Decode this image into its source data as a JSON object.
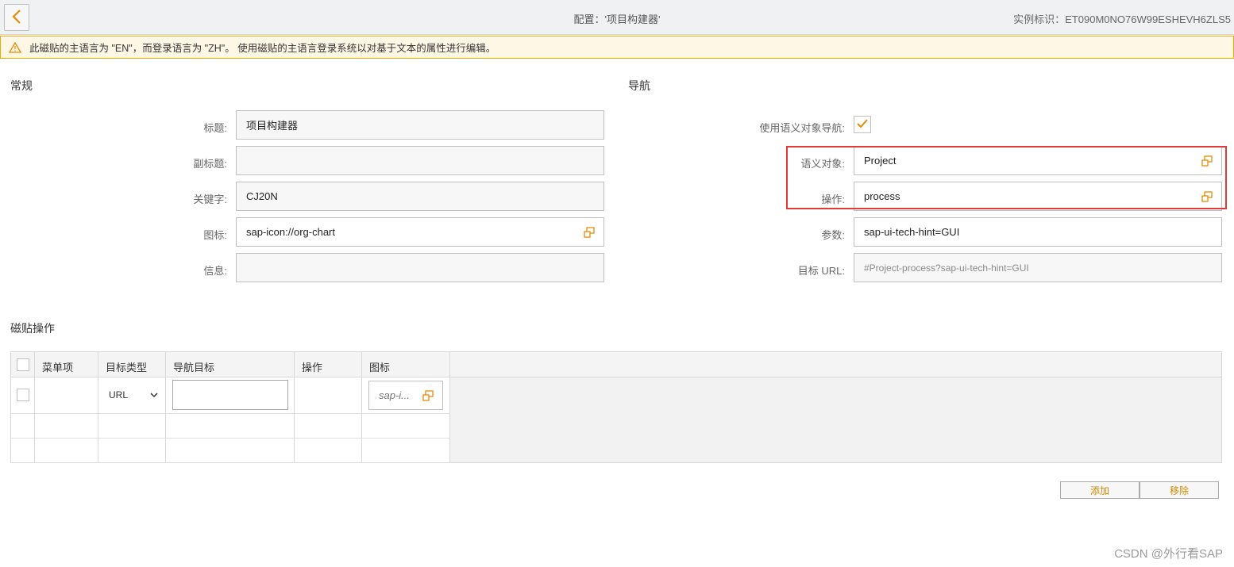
{
  "header": {
    "title": "配置：'项目构建器'",
    "instance_id": "实例标识：ET090M0NO76W99ESHEVH6ZLS5"
  },
  "warning": {
    "text": "此磁贴的主语言为 \"EN\"，而登录语言为 \"ZH\"。 使用磁贴的主语言登录系统以对基于文本的属性进行编辑。"
  },
  "general": {
    "section_title": "常规",
    "title_label": "标题:",
    "title_value": "项目构建器",
    "subtitle_label": "副标题:",
    "subtitle_value": "",
    "keywords_label": "关键字:",
    "keywords_value": "CJ20N",
    "icon_label": "图标:",
    "icon_value": "sap-icon://org-chart",
    "info_label": "信息:",
    "info_value": ""
  },
  "navigation": {
    "section_title": "导航",
    "use_semantic_label": "使用语义对象导航:",
    "use_semantic_checked": true,
    "semantic_object_label": "语义对象:",
    "semantic_object_value": "Project",
    "action_label": "操作:",
    "action_value": "process",
    "params_label": "参数:",
    "params_value": "sap-ui-tech-hint=GUI",
    "target_url_label": "目标 URL:",
    "target_url_value": "#Project-process?sap-ui-tech-hint=GUI"
  },
  "tile_actions": {
    "section_title": "磁贴操作",
    "columns": [
      "菜单项",
      "目标类型",
      "导航目标",
      "操作",
      "图标"
    ],
    "row1": {
      "target_type": "URL",
      "icon_placeholder": "sap-i..."
    },
    "add_button": "添加",
    "remove_button": "移除"
  },
  "watermark": "CSDN @外行看SAP",
  "colors": {
    "accent": "#e78c07",
    "highlight": "#e53935",
    "warning_border": "#f0ab00"
  }
}
